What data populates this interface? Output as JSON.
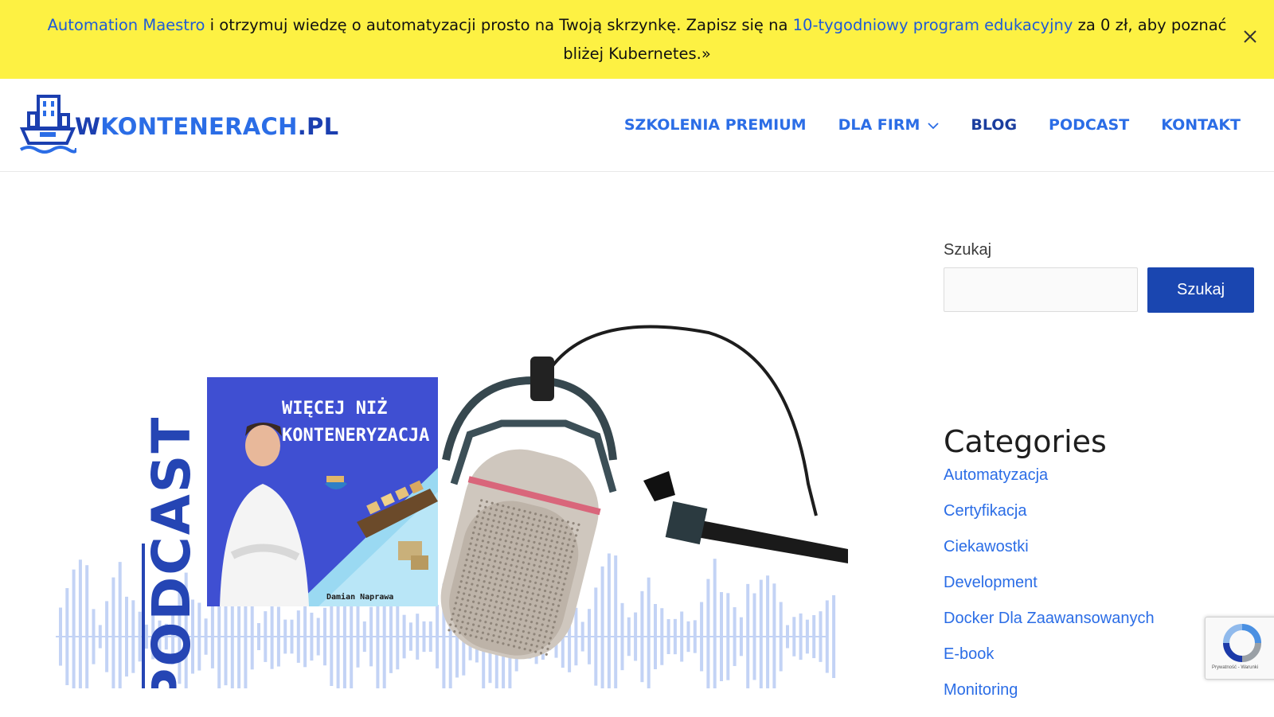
{
  "banner": {
    "link1": "Automation Maestro",
    "text1": " i otrzymuj wiedzę o automatyzacji prosto na Twoją skrzynkę. Zapisz się na ",
    "link2": "10-tygodniowy program edukacyjny",
    "text2": " za 0 zł, aby poznać bliżej Kubernetes.»"
  },
  "logo": {
    "w": "W",
    "main": "KONTENERACH",
    "tld": ".PL"
  },
  "nav": [
    {
      "label": "SZKOLENIA PREMIUM"
    },
    {
      "label": "DLA FIRM"
    },
    {
      "label": "BLOG"
    },
    {
      "label": "PODCAST"
    },
    {
      "label": "KONTAKT"
    }
  ],
  "hero": {
    "vertical_text": "PODCAST",
    "cover_title_line1": "WIĘCEJ NIŻ",
    "cover_title_line2": "KONTENERYZACJA",
    "cover_author": "Damian Naprawa"
  },
  "search": {
    "label": "Szukaj",
    "value": "",
    "button": "Szukaj"
  },
  "categories": {
    "title": "Categories",
    "items": [
      "Automatyzacja",
      "Certyfikacja",
      "Ciekawostki",
      "Development",
      "Docker Dla Zaawansowanych",
      "E-book",
      "Monitoring"
    ]
  },
  "recaptcha": {
    "text": "Prywatność - Warunki"
  },
  "colors": {
    "banner": "#fdf143",
    "link": "#2b6de6",
    "brand_dark": "#1a46b0",
    "nav_active": "#1a3d9e"
  }
}
